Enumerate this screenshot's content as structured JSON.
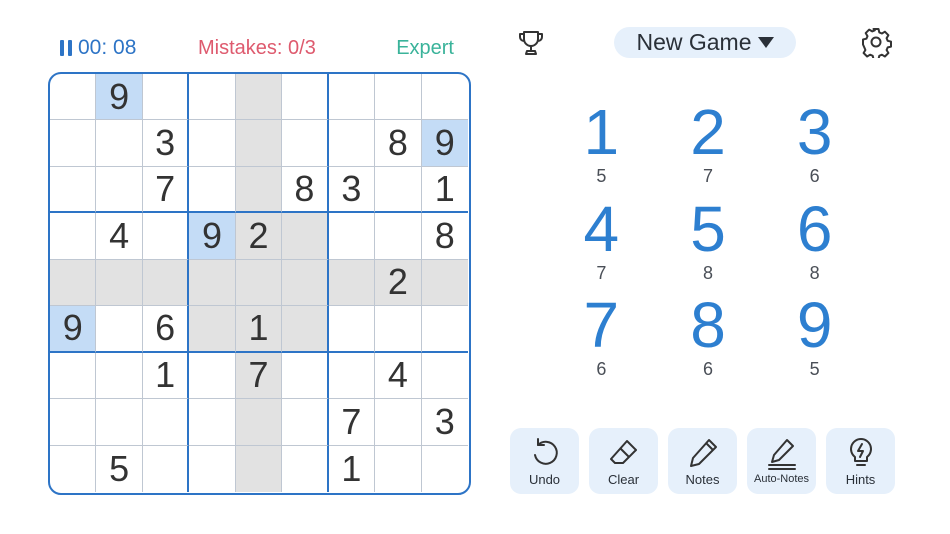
{
  "header": {
    "timer": "00: 08",
    "mistakes": "Mistakes: 0/3",
    "difficulty": "Expert"
  },
  "top_actions": {
    "new_game_label": "New Game"
  },
  "board": {
    "rows": [
      [
        "",
        "9",
        "",
        "",
        "",
        "",
        "",
        "",
        ""
      ],
      [
        "",
        "",
        "3",
        "",
        "",
        "",
        "",
        "8",
        "9"
      ],
      [
        "",
        "",
        "7",
        "",
        "",
        "8",
        "3",
        "",
        "1"
      ],
      [
        "",
        "4",
        "",
        "9",
        "2",
        "",
        "",
        "",
        "8"
      ],
      [
        "",
        "",
        "",
        "",
        "",
        "",
        "",
        "2",
        ""
      ],
      [
        "9",
        "",
        "6",
        "",
        "1",
        "",
        "",
        "",
        ""
      ],
      [
        "",
        "",
        "1",
        "",
        "7",
        "",
        "",
        "4",
        ""
      ],
      [
        "",
        "",
        "",
        "",
        "",
        "",
        "7",
        "",
        "3"
      ],
      [
        "",
        "5",
        "",
        "",
        "",
        "",
        "1",
        "",
        ""
      ]
    ],
    "selected": {
      "row": 4,
      "col": 4
    },
    "highlight_color": "#e2e2e2",
    "same_number_color": "#c4dcf6",
    "same_number_value": "9"
  },
  "numpad": [
    {
      "digit": "1",
      "remaining": "5"
    },
    {
      "digit": "2",
      "remaining": "7"
    },
    {
      "digit": "3",
      "remaining": "6"
    },
    {
      "digit": "4",
      "remaining": "7"
    },
    {
      "digit": "5",
      "remaining": "8"
    },
    {
      "digit": "6",
      "remaining": "8"
    },
    {
      "digit": "7",
      "remaining": "6"
    },
    {
      "digit": "8",
      "remaining": "6"
    },
    {
      "digit": "9",
      "remaining": "5"
    }
  ],
  "actions": [
    {
      "key": "undo",
      "label": "Undo",
      "icon": "undo-icon"
    },
    {
      "key": "clear",
      "label": "Clear",
      "icon": "eraser-icon"
    },
    {
      "key": "notes",
      "label": "Notes",
      "icon": "pencil-icon"
    },
    {
      "key": "auto_notes",
      "label": "Auto-Notes",
      "icon": "auto-notes-icon"
    },
    {
      "key": "hints",
      "label": "Hints",
      "icon": "lightbulb-icon"
    }
  ],
  "colors": {
    "accent": "#2d74c6",
    "mistakes": "#de5a6e",
    "difficulty": "#3ab39a",
    "button_bg": "#e6f0fb"
  }
}
